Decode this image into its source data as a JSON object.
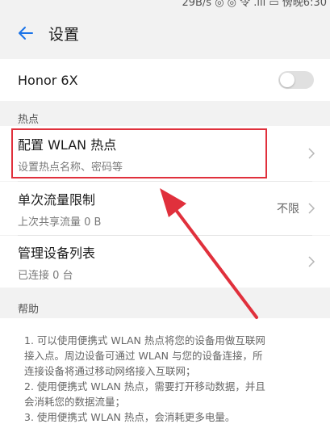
{
  "status_bar": {
    "text": "29B/s ◎ ◎ 令 .ill ▭ 傍晚6:30"
  },
  "header": {
    "title": "设置"
  },
  "device": {
    "name": "Honor 6X",
    "toggle_on": false
  },
  "sections": {
    "hotspot": "热点",
    "help": "帮助"
  },
  "items": [
    {
      "title": "配置 WLAN 热点",
      "subtitle": "设置热点名称、密码等",
      "value": ""
    },
    {
      "title": "单次流量限制",
      "subtitle": "上次共享流量 0 B",
      "value": "不限"
    },
    {
      "title": "管理设备列表",
      "subtitle": "已连接 0 台",
      "value": ""
    }
  ],
  "help_lines": [
    "1. 可以使用便携式 WLAN 热点将您的设备用做互联网",
    "接入点。周边设备可通过 WLAN 与您的设备连接，所",
    "连接设备将通过移动网络接入互联网；",
    "2. 使用便携式 WLAN 热点，需要打开移动数据，并且",
    "会消耗您的数据流量；",
    "3. 使用便携式 WLAN 热点，会消耗更多电量。"
  ],
  "colors": {
    "accent": "#1a73e8",
    "highlight": "#e0303c",
    "background": "#f2f2f2"
  }
}
